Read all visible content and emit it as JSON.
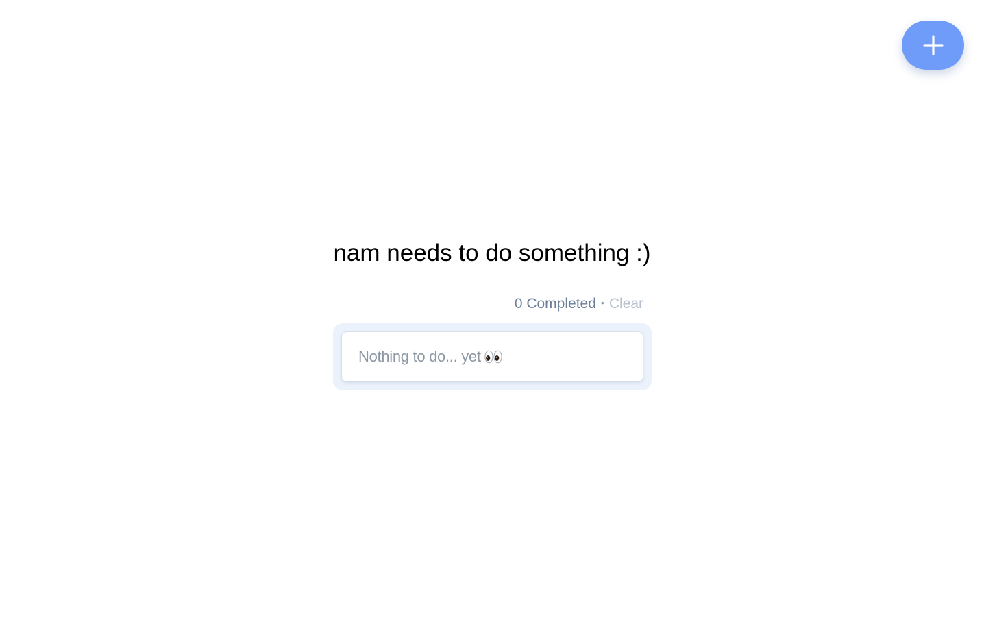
{
  "fab": {
    "icon": "plus-icon",
    "color": "#6f9cf8"
  },
  "header": {
    "title": "nam needs to do something :)"
  },
  "status": {
    "completed_label": "0 Completed",
    "separator": "•",
    "clear_label": "Clear"
  },
  "todo_list": {
    "empty_message": "Nothing to do... yet",
    "empty_icon": "eyes-icon"
  }
}
